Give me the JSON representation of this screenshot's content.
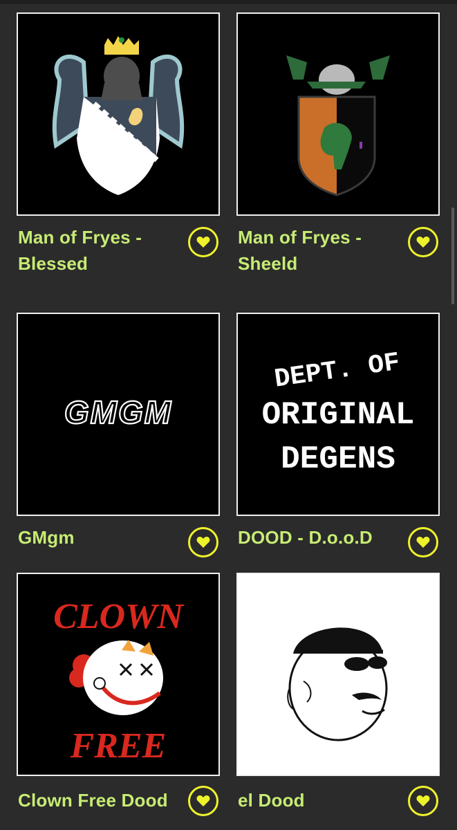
{
  "colors": {
    "background": "#2b2b2b",
    "title": "#c7ec74",
    "heart_accent": "#eef22b",
    "thumb_border": "#f1f1f1"
  },
  "items": [
    {
      "title": "Man of Fryes - Blessed",
      "favorite_icon": "heart-icon"
    },
    {
      "title": "Man of Fryes - Sheeld",
      "favorite_icon": "heart-icon"
    },
    {
      "title": "GMgm",
      "favorite_icon": "heart-icon",
      "art_text": "GMGM"
    },
    {
      "title": "DOOD - D.o.o.D",
      "favorite_icon": "heart-icon",
      "art_text": [
        "DEPT. OF",
        "ORIGINAL",
        "DEGENS"
      ]
    },
    {
      "title": "Clown Free Dood",
      "favorite_icon": "heart-icon",
      "art_text": [
        "CLOWN",
        "FREE"
      ]
    },
    {
      "title": "el Dood",
      "favorite_icon": "heart-icon"
    }
  ]
}
